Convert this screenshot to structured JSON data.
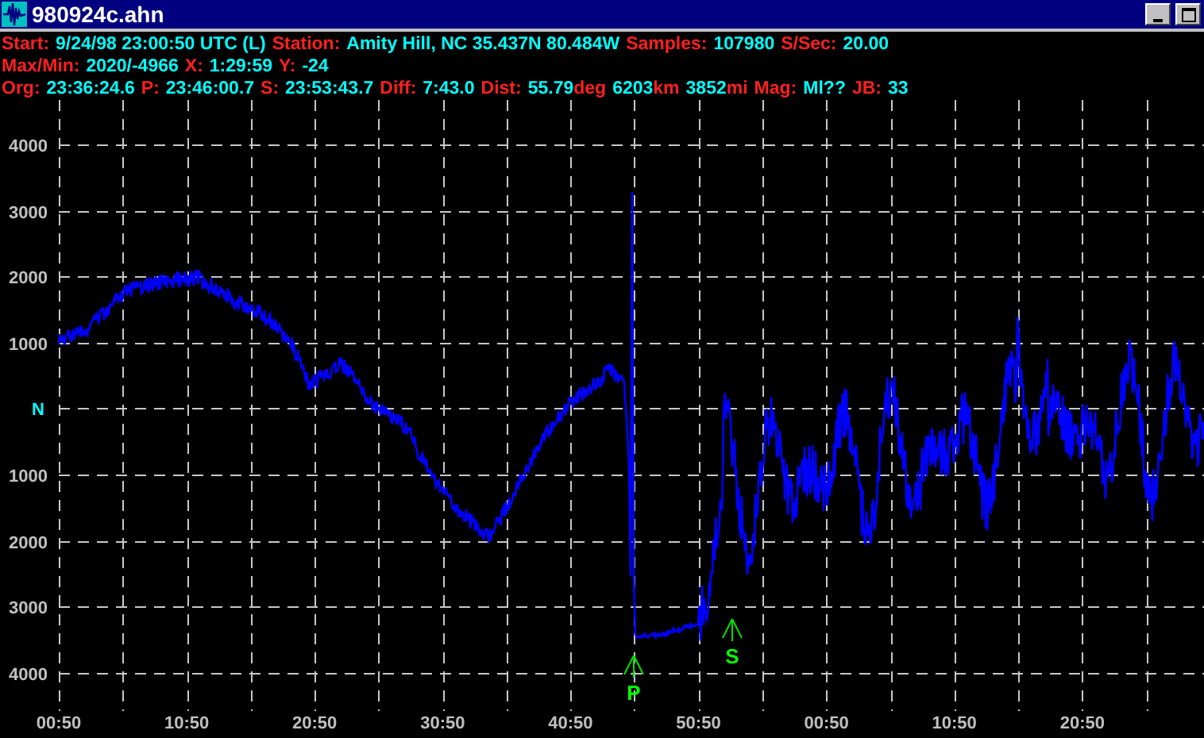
{
  "window": {
    "title": "980924c.ahn"
  },
  "info_lines": [
    [
      {
        "kind": "label",
        "text": "Start:"
      },
      {
        "kind": "value",
        "text": "9/24/98 23:00:50 UTC (L)"
      },
      {
        "kind": "label",
        "text": "Station:"
      },
      {
        "kind": "value",
        "text": "Amity Hill, NC 35.437N 80.484W"
      },
      {
        "kind": "label",
        "text": "Samples:"
      },
      {
        "kind": "value",
        "text": "107980"
      },
      {
        "kind": "label",
        "text": "S/Sec:"
      },
      {
        "kind": "value",
        "text": "20.00"
      }
    ],
    [
      {
        "kind": "label",
        "text": "Max/Min:"
      },
      {
        "kind": "value",
        "text": "2020/-4966"
      },
      {
        "kind": "label",
        "text": "X:"
      },
      {
        "kind": "value",
        "text": "1:29:59"
      },
      {
        "kind": "label",
        "text": "Y:"
      },
      {
        "kind": "value",
        "text": "-24"
      }
    ],
    [
      {
        "kind": "label",
        "text": "Org:"
      },
      {
        "kind": "value",
        "text": "23:36:24.6"
      },
      {
        "kind": "label",
        "text": "P:"
      },
      {
        "kind": "value",
        "text": "23:46:00.7"
      },
      {
        "kind": "label",
        "text": "S:"
      },
      {
        "kind": "value",
        "text": "23:53:43.7"
      },
      {
        "kind": "label",
        "text": "Diff:"
      },
      {
        "kind": "value",
        "text": "7:43.0"
      },
      {
        "kind": "label",
        "text": "Dist:"
      },
      {
        "kind": "value",
        "text": "55.79"
      },
      {
        "kind": "unit",
        "text": "deg"
      },
      {
        "kind": "value",
        "text": "6203"
      },
      {
        "kind": "unit",
        "text": "km"
      },
      {
        "kind": "value",
        "text": "3852"
      },
      {
        "kind": "unit",
        "text": "mi"
      },
      {
        "kind": "label",
        "text": "Mag:"
      },
      {
        "kind": "value",
        "text": "Ml??"
      },
      {
        "kind": "label",
        "text": "JB:"
      },
      {
        "kind": "value",
        "text": "33"
      }
    ]
  ],
  "plot": {
    "y_labels": [
      {
        "text": "4000",
        "kind": "amplitude"
      },
      {
        "text": "3000",
        "kind": "amplitude"
      },
      {
        "text": "2000",
        "kind": "amplitude"
      },
      {
        "text": "1000",
        "kind": "amplitude"
      },
      {
        "text": "N",
        "kind": "zero"
      },
      {
        "text": "1000",
        "kind": "amplitude"
      },
      {
        "text": "2000",
        "kind": "amplitude"
      },
      {
        "text": "3000",
        "kind": "amplitude"
      },
      {
        "text": "4000",
        "kind": "amplitude"
      }
    ],
    "x_labels": [
      "00:50",
      "10:50",
      "20:50",
      "30:50",
      "40:50",
      "50:50",
      "00:50",
      "10:50",
      "20:50"
    ],
    "picks": [
      {
        "label": "P"
      },
      {
        "label": "S"
      }
    ]
  }
}
